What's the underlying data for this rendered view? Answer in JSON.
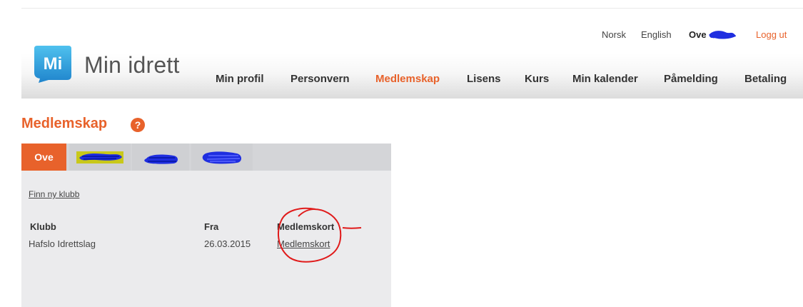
{
  "header": {
    "utility_links": [
      "Norsk",
      "English"
    ],
    "user_name": "Ove",
    "logout_label": "Logg ut",
    "logo_text": "Mi",
    "brand_name": "Min idrett",
    "nav": [
      "Min profil",
      "Personvern",
      "Medlemskap",
      "Lisens",
      "Kurs",
      "Min kalender",
      "Påmelding",
      "Betaling"
    ],
    "active_nav": "Medlemskap"
  },
  "page": {
    "title": "Medlemskap",
    "help_glyph": "?"
  },
  "membership": {
    "tabs": [
      {
        "label": "Ove",
        "active": true
      },
      {
        "label": "",
        "active": false,
        "redacted": true
      },
      {
        "label": "",
        "active": false,
        "redacted": true
      },
      {
        "label": "",
        "active": false,
        "redacted": true
      }
    ],
    "find_club_link": "Finn ny klubb",
    "columns": [
      "Klubb",
      "Fra",
      "Medlemskort"
    ],
    "rows": [
      {
        "club": "Hafslo Idrettslag",
        "from": "26.03.2015",
        "card_link": "Medlemskort"
      }
    ]
  },
  "colors": {
    "accent": "#e8622b",
    "logo_blue": "#1f9ad6",
    "scribble_blue": "#1f2ee0",
    "annotation_red": "#e01a1a"
  }
}
